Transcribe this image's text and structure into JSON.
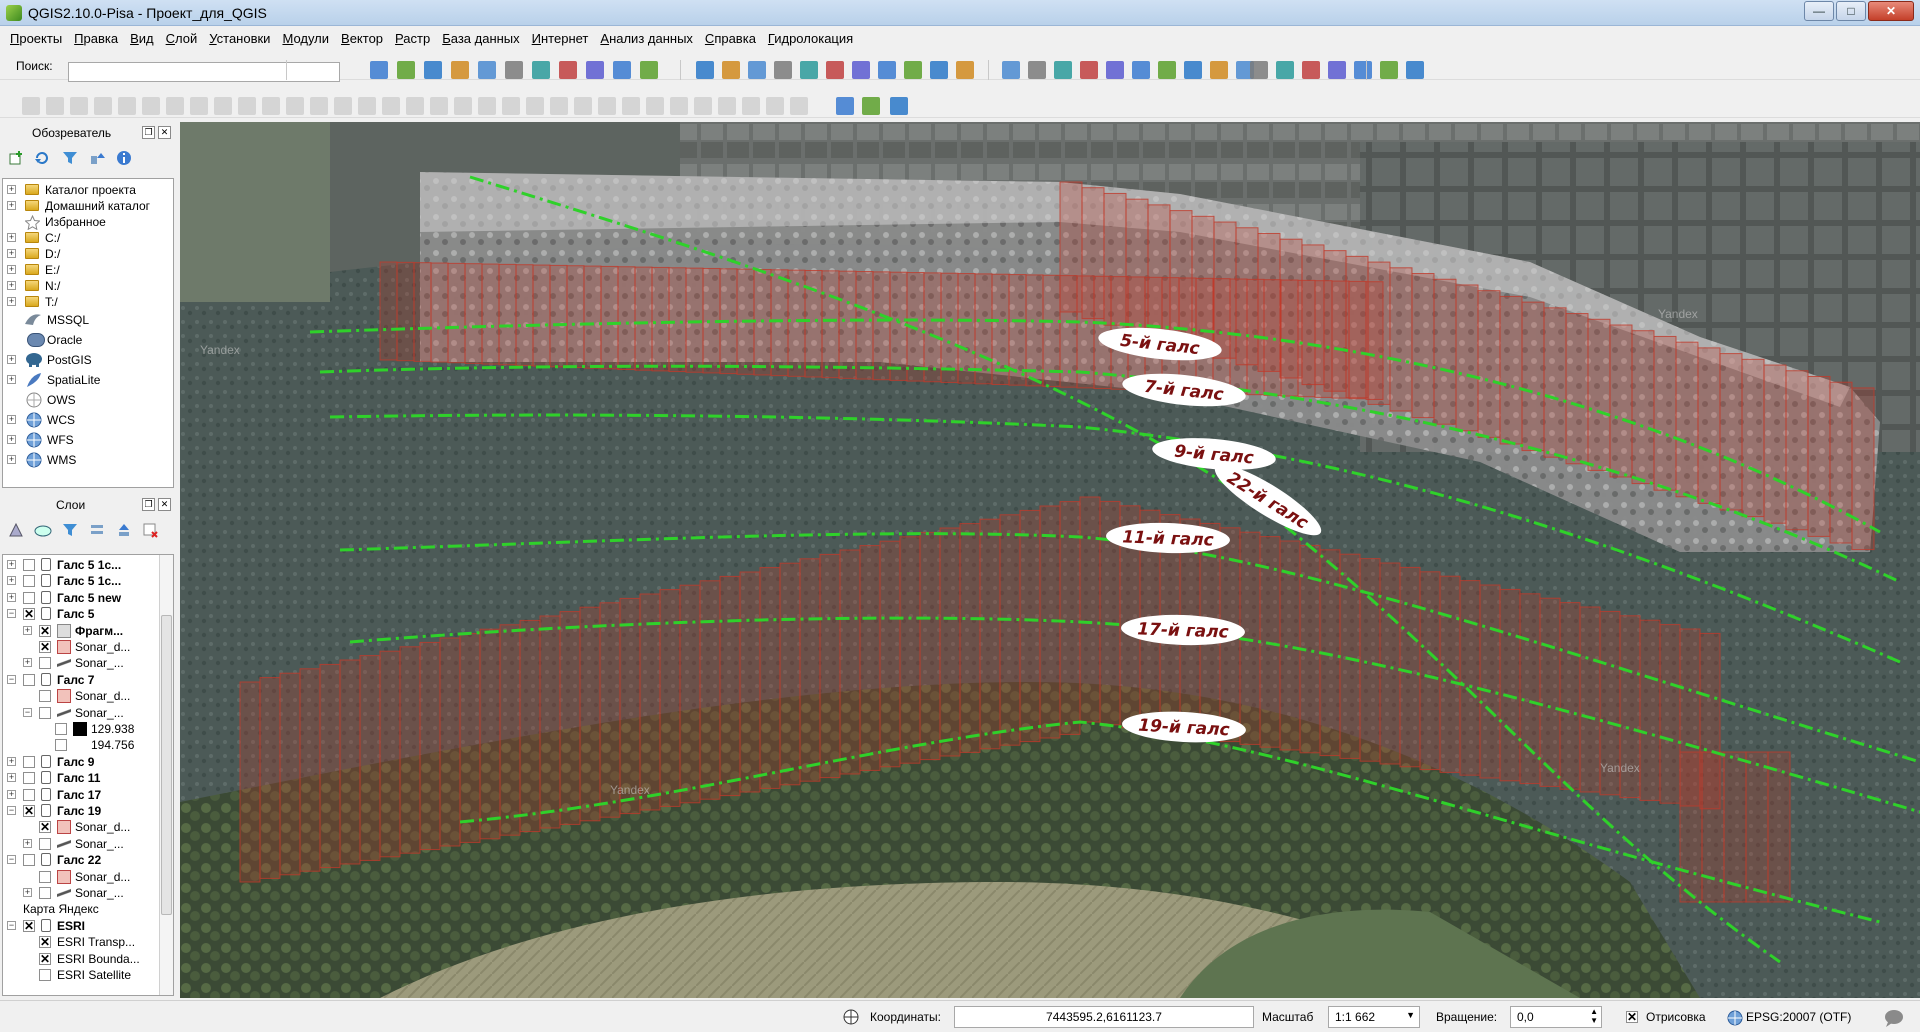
{
  "window": {
    "title": "QGIS2.10.0-Pisa - Проект_для_QGIS",
    "btn_min": "—",
    "btn_max": "□",
    "btn_close": "✕"
  },
  "menu": [
    "Проекты",
    "Правка",
    "Вид",
    "Слой",
    "Установки",
    "Модули",
    "Вектор",
    "Растр",
    "База данных",
    "Интернет",
    "Анализ данных",
    "Справка",
    "Гидролокация"
  ],
  "search": {
    "label": "Поиск:",
    "value": ""
  },
  "browser": {
    "title": "Обозреватель",
    "items": [
      "Каталог проекта",
      "Домашний каталог",
      "Избранное",
      "C:/",
      "D:/",
      "E:/",
      "N:/",
      "T:/",
      "MSSQL",
      "Oracle",
      "PostGIS",
      "SpatiaLite",
      "OWS",
      "WCS",
      "WFS",
      "WMS"
    ]
  },
  "layers": {
    "title": "Слои",
    "items": [
      "Галс 5 1с...",
      "Галс 5 1с...",
      "Галс 5 new",
      "Галс 5",
      "Фрагм...",
      "Sonar_d...",
      "Sonar_...",
      "Галс 7",
      "Sonar_d...",
      "Sonar_...",
      "129.938",
      "194.756",
      "Галс 9",
      "Галс 11",
      "Галс 17",
      "Галс 19",
      "Sonar_d...",
      "Sonar_...",
      "Галс 22",
      "Sonar_d...",
      "Sonar_...",
      "Карта Яндекс",
      "ESRI",
      "ESRI Transp...",
      "ESRI Bounda...",
      "ESRI Satellite"
    ]
  },
  "map": {
    "labels": [
      "5-й галс",
      "7-й галс",
      "9-й галс",
      "22-й галс",
      "11-й галс",
      "17-й галс",
      "19-й галс"
    ],
    "watermark": "Yandex"
  },
  "status": {
    "coord_label": "Координаты:",
    "coord_value": "7443595.2,6161123.7",
    "scale_label": "Масштаб",
    "scale_value": "1:1 662",
    "rotation_label": "Вращение:",
    "rotation_value": "0,0",
    "render_label": "Отрисовка",
    "crs": "EPSG:20007 (OTF)"
  }
}
